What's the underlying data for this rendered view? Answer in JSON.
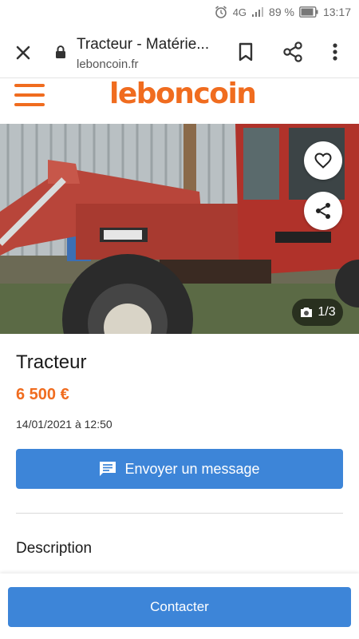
{
  "status_bar": {
    "network": "4G",
    "battery": "89 %",
    "time": "13:17",
    "icons": [
      "alarm-icon",
      "signal-icon",
      "battery-icon"
    ]
  },
  "browser": {
    "page_title": "Tracteur - Matérie...",
    "url": "leboncoin.fr",
    "icons": [
      "close-icon",
      "lock-icon",
      "bookmark-icon",
      "share-icon",
      "more-vert-icon"
    ]
  },
  "site": {
    "logo": "leboncoin",
    "brand_color": "#f06c1f",
    "icons": [
      "hamburger-menu-icon"
    ]
  },
  "photo": {
    "counter": "1/3",
    "icons": [
      "heart-icon",
      "share-icon",
      "camera-icon"
    ]
  },
  "ad": {
    "title": "Tracteur",
    "price": "6 500 €",
    "date": "14/01/2021 à 12:50"
  },
  "actions": {
    "message_label": "Envoyer un message",
    "contact_label": "Contacter",
    "button_color": "#3d85d8",
    "icons": [
      "chat-icon"
    ]
  },
  "description": {
    "heading": "Description"
  }
}
